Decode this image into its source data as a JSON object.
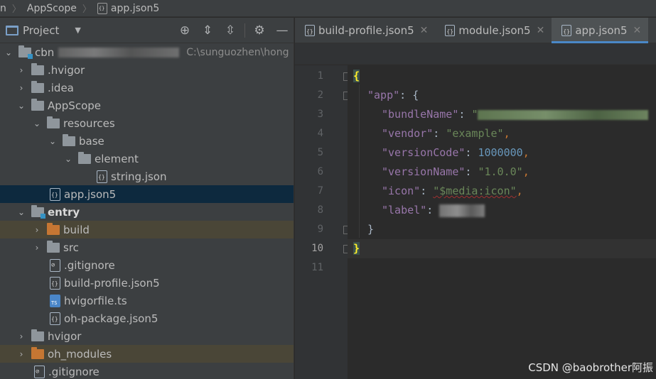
{
  "breadcrumb": {
    "items": [
      "n",
      "AppScope",
      "app.json5"
    ]
  },
  "project_panel": {
    "title": "Project",
    "tools": [
      "target-icon",
      "expand-all-icon",
      "collapse-all-icon",
      "gear-icon",
      "minimize-icon"
    ],
    "root": {
      "name": "cbn",
      "path": "C:\\sunguozhen\\hong"
    },
    "items": [
      {
        "label": ".hvigor"
      },
      {
        "label": ".idea"
      },
      {
        "label": "AppScope"
      },
      {
        "label": "resources"
      },
      {
        "label": "base"
      },
      {
        "label": "element"
      },
      {
        "label": "string.json"
      },
      {
        "label": "app.json5"
      },
      {
        "label": "entry"
      },
      {
        "label": "build"
      },
      {
        "label": "src"
      },
      {
        "label": ".gitignore"
      },
      {
        "label": "build-profile.json5"
      },
      {
        "label": "hvigorfile.ts"
      },
      {
        "label": "oh-package.json5"
      },
      {
        "label": "hvigor"
      },
      {
        "label": "oh_modules"
      },
      {
        "label": ".gitignore"
      }
    ]
  },
  "tabs": [
    {
      "label": "build-profile.json5"
    },
    {
      "label": "module.json5"
    },
    {
      "label": "app.json5"
    }
  ],
  "editor": {
    "line_numbers": [
      "1",
      "2",
      "3",
      "4",
      "5",
      "6",
      "7",
      "8",
      "9",
      "10",
      "11"
    ],
    "current_line": "10",
    "code": {
      "open_brace": "{",
      "app_key": "\"app\"",
      "colon": ": ",
      "obj_open": "{",
      "bundleName_key": "\"bundleName\"",
      "bundleName_val": "\"",
      "vendor_key": "\"vendor\"",
      "vendor_val": "\"example\"",
      "versionCode_key": "\"versionCode\"",
      "versionCode_val": "1000000",
      "versionName_key": "\"versionName\"",
      "versionName_val": "\"1.0.0\"",
      "icon_key": "\"icon\"",
      "icon_val": "\"$media:icon\"",
      "label_key": "\"label\"",
      "comma": ",",
      "obj_close": "}",
      "close_brace": "}"
    }
  },
  "watermark": "CSDN @baobrother阿振",
  "colors": {
    "accent": "#4a88c7",
    "selected_row": "#0d293e",
    "key": "#9876aa",
    "string": "#6a8759",
    "number": "#6897bb"
  }
}
